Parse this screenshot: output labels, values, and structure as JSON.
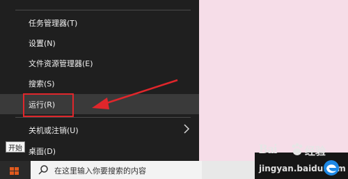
{
  "menu": {
    "items": [
      {
        "label": "任务管理器(T)"
      },
      {
        "label": "设置(N)"
      },
      {
        "label": "文件资源管理器(E)"
      },
      {
        "label": "搜索(S)"
      },
      {
        "label": "运行(R)"
      },
      {
        "label": "关机或注销(U)"
      },
      {
        "label": "桌面(D)"
      }
    ]
  },
  "tooltip": {
    "start": "开始"
  },
  "taskbar": {
    "search_placeholder": "在这里输入你要搜索的内容"
  },
  "watermark": {
    "brand": "Bai",
    "brand_cn": "经验",
    "url": "jingyan.baidu.com"
  },
  "colors": {
    "menu_bg": "#1f1f1f",
    "highlight": "#3a3a3a",
    "annotation": "#e0262b",
    "desktop": "#f6dde8"
  },
  "icons": [
    "chevron-right-icon",
    "windows-logo-icon",
    "search-icon",
    "edge-icon",
    "baidu-paw-icon"
  ]
}
